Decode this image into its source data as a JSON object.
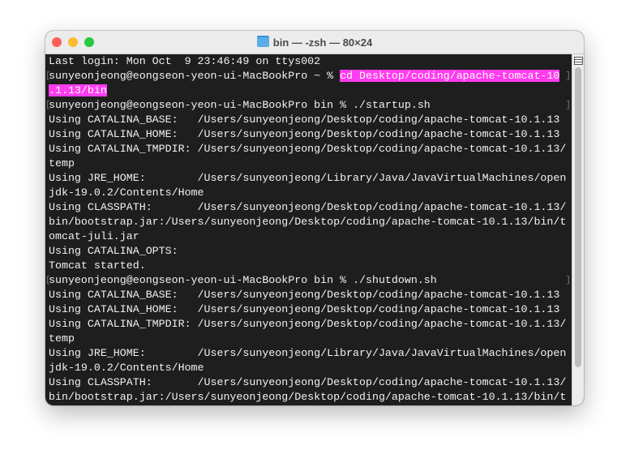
{
  "window": {
    "title": "bin — -zsh — 80×24"
  },
  "lines": [
    {
      "text": "Last login: Mon Oct  9 23:46:49 on ttys002"
    },
    {
      "text": "sunyeonjeong@eongseon-yeon-ui-MacBookPro ~ % ",
      "hl": "cd Desktop/coding/apache-tomcat-10",
      "prompt": true
    },
    {
      "text": "",
      "hl": ".1.13/bin"
    },
    {
      "text": "sunyeonjeong@eongseon-yeon-ui-MacBookPro bin % ./startup.sh",
      "prompt": true
    },
    {
      "text": "Using CATALINA_BASE:   /Users/sunyeonjeong/Desktop/coding/apache-tomcat-10.1.13"
    },
    {
      "text": "Using CATALINA_HOME:   /Users/sunyeonjeong/Desktop/coding/apache-tomcat-10.1.13"
    },
    {
      "text": "Using CATALINA_TMPDIR: /Users/sunyeonjeong/Desktop/coding/apache-tomcat-10.1.13/"
    },
    {
      "text": "temp"
    },
    {
      "text": "Using JRE_HOME:        /Users/sunyeonjeong/Library/Java/JavaVirtualMachines/open"
    },
    {
      "text": "jdk-19.0.2/Contents/Home"
    },
    {
      "text": "Using CLASSPATH:       /Users/sunyeonjeong/Desktop/coding/apache-tomcat-10.1.13/"
    },
    {
      "text": "bin/bootstrap.jar:/Users/sunyeonjeong/Desktop/coding/apache-tomcat-10.1.13/bin/t"
    },
    {
      "text": "omcat-juli.jar"
    },
    {
      "text": "Using CATALINA_OPTS:"
    },
    {
      "text": "Tomcat started."
    },
    {
      "text": "sunyeonjeong@eongseon-yeon-ui-MacBookPro bin % ./shutdown.sh",
      "prompt": true
    },
    {
      "text": "Using CATALINA_BASE:   /Users/sunyeonjeong/Desktop/coding/apache-tomcat-10.1.13"
    },
    {
      "text": "Using CATALINA_HOME:   /Users/sunyeonjeong/Desktop/coding/apache-tomcat-10.1.13"
    },
    {
      "text": "Using CATALINA_TMPDIR: /Users/sunyeonjeong/Desktop/coding/apache-tomcat-10.1.13/"
    },
    {
      "text": "temp"
    },
    {
      "text": "Using JRE_HOME:        /Users/sunyeonjeong/Library/Java/JavaVirtualMachines/open"
    },
    {
      "text": "jdk-19.0.2/Contents/Home"
    },
    {
      "text": "Using CLASSPATH:       /Users/sunyeonjeong/Desktop/coding/apache-tomcat-10.1.13/"
    },
    {
      "text": "bin/bootstrap.jar:/Users/sunyeonjeong/Desktop/coding/apache-tomcat-10.1.13/bin/t"
    }
  ],
  "colors": {
    "highlight": "#ff3cf0",
    "background": "#1e1e1e"
  }
}
